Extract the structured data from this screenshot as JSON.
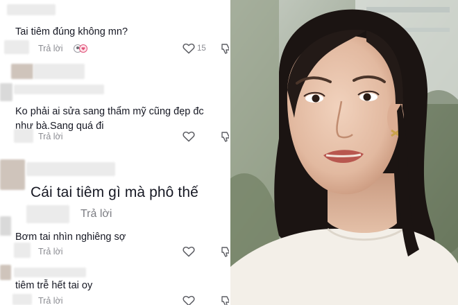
{
  "comments": [
    {
      "text": "Tai tiêm đúng không mn?",
      "reply": "Trả lời",
      "likes": "15"
    },
    {
      "text": "Ko phải ai sửa sang thẩm mỹ cũng đẹp đc như bà.Sang quá đi",
      "reply": "Trả lời"
    },
    {
      "text": "Cái tai tiêm gì mà phô thế",
      "reply": "Trả lời"
    },
    {
      "text": "Bơm tai nhìn nghiêng sợ",
      "reply": "Trả lời"
    },
    {
      "text": "tiêm trễ hết tai oy",
      "reply": "Trả lời"
    }
  ],
  "colors": {
    "text": "#161823",
    "muted": "#8a8b91",
    "background": "#ffffff"
  },
  "icons": [
    "heart-icon",
    "dislike-icon",
    "reaction-avatars-icon"
  ]
}
